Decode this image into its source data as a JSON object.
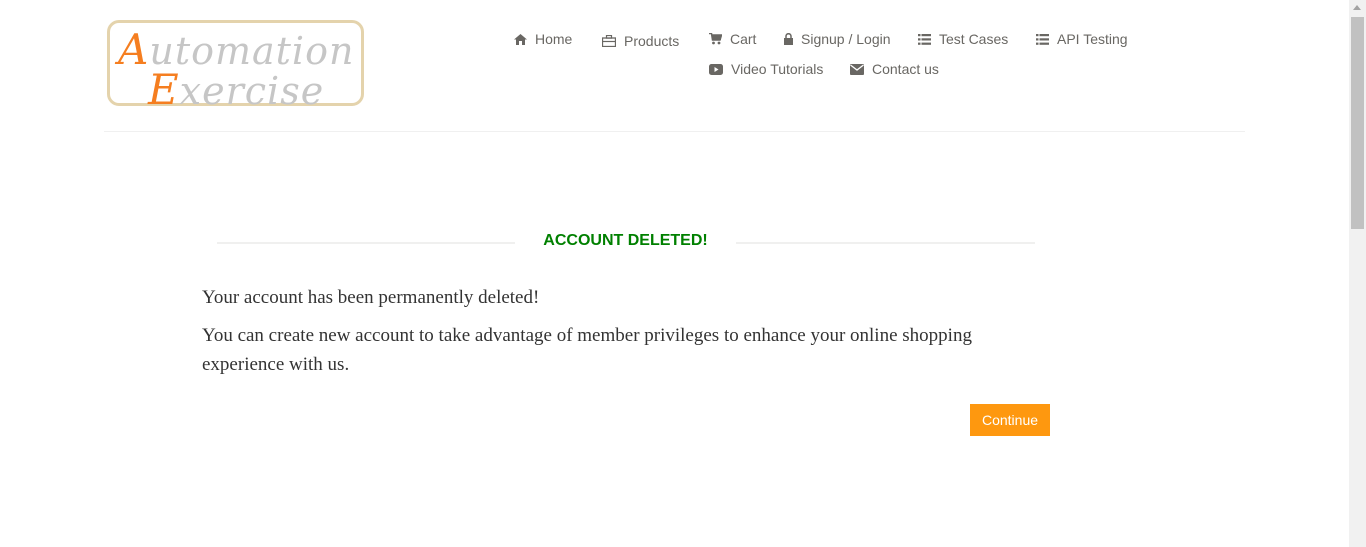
{
  "logo": {
    "line1_cap": "A",
    "line1_rest": "utomation",
    "line2_cap": "E",
    "line2_rest": "xercise"
  },
  "nav": {
    "home": "Home",
    "products": "Products",
    "cart": "Cart",
    "login": "Signup / Login",
    "test_cases": "Test Cases",
    "api_testing": "API Testing",
    "video_tutorials": "Video Tutorials",
    "contact_us": "Contact us"
  },
  "main": {
    "title": "ACCOUNT DELETED!",
    "message_1": "Your account has been permanently deleted!",
    "message_2": "You can create new account to take advantage of member privileges to enhance your online shopping experience with us.",
    "continue_label": "Continue"
  },
  "colors": {
    "accent": "#fe980f",
    "title_green": "#008000",
    "nav_text": "#696763"
  }
}
